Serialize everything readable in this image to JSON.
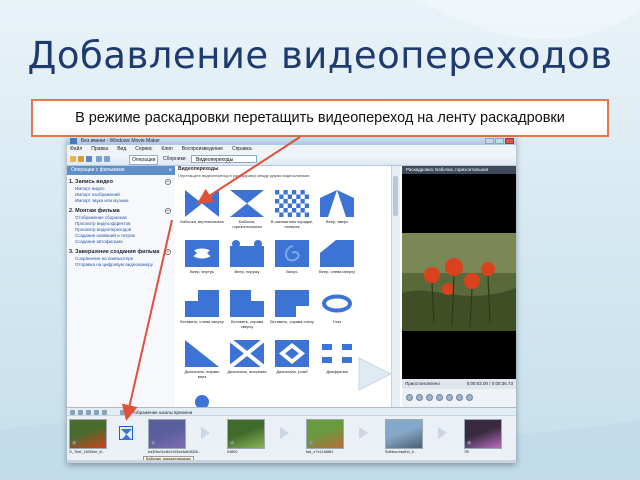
{
  "slide": {
    "title": "Добавление видеопереходов",
    "caption": "В режиме раскадровки перетащить видеопереход на ленту раскадровки"
  },
  "app": {
    "window_title": "Без имени - Windows Movie Maker",
    "menu": [
      "Файл",
      "Правка",
      "Вид",
      "Сервис",
      "Клип",
      "Воспроизведение",
      "Справка"
    ],
    "toolbar": {
      "tasks_label": "Операции",
      "collections_label": "Сборники",
      "collection_select": "Видеопереходы"
    },
    "task_pane": {
      "header": "Операции с фильмами",
      "sections": [
        {
          "number": "1.",
          "title": "Запись видео",
          "links": [
            "Импорт видео",
            "Импорт изображений",
            "Импорт звука или музыки"
          ]
        },
        {
          "number": "2.",
          "title": "Монтаж фильма",
          "links": [
            "Отображение сборников",
            "Просмотр видеоэффектов",
            "Просмотр видеопереходов",
            "Создание названий и титров",
            "Создание автофильма"
          ]
        },
        {
          "number": "3.",
          "title": "Завершение создания фильма",
          "links": [
            "Сохранение на компьютере",
            "Отправка на цифровую видеокамеру"
          ]
        }
      ]
    },
    "content": {
      "heading": "Видеопереходы",
      "subheading": "Перетащите видеопереход в раскадровку между двумя видеоклипами.",
      "transitions": [
        {
          "name": "Бабочка, вертикальная",
          "icon": "bowtie-vertical-icon"
        },
        {
          "name": "Бабочка, горизонтальная",
          "icon": "bowtie-horizontal-icon"
        },
        {
          "name": "В шахматном порядке, поперек",
          "icon": "checker-icon"
        },
        {
          "name": "Веер, вверх",
          "icon": "fan-up-icon"
        },
        {
          "name": "Веер, внутрь",
          "icon": "fan-in-icon"
        },
        {
          "name": "Веер, наружу",
          "icon": "fan-out-icon"
        },
        {
          "name": "Вихрь",
          "icon": "swirl-icon"
        },
        {
          "name": "Веер, слева сверху",
          "icon": "fan-topleft-icon"
        },
        {
          "name": "Вставить, слева сверху",
          "icon": "insert-topleft-icon"
        },
        {
          "name": "Вставить, справа сверху",
          "icon": "insert-topright-icon"
        },
        {
          "name": "Вставить, справа снизу",
          "icon": "insert-bottomright-icon"
        },
        {
          "name": "Глаз",
          "icon": "eye-icon"
        },
        {
          "name": "Диагональ, вправо вниз",
          "icon": "diagonal-down-icon"
        },
        {
          "name": "Диагональ, вихревая",
          "icon": "diagonal-cross-icon"
        },
        {
          "name": "Диагональ, ромб",
          "icon": "diamond-icon"
        },
        {
          "name": "Диафрагма",
          "icon": "iris-icon"
        },
        {
          "name": "",
          "icon": "circle-icon"
        }
      ]
    },
    "preview": {
      "title": "Раскадровка: Бабочка, горизонтальная",
      "status": "Приостановлено",
      "time": "0:00:02.00 / 0:00:36.73"
    },
    "storyboard": {
      "toolbar_label": "Отображение шкалы времени",
      "tooltip": "Бабочка, горизонтальная",
      "clips": [
        {
          "name": "G_7bef_180f3ee_ill..",
          "colors": [
            "#4b6b2d",
            "#d0401e"
          ]
        },
        {
          "name": "ba30bcf1efb1f1/f3ee8dk3f32b..",
          "colors": [
            "#5a5e9c",
            "#7d6bb0"
          ]
        },
        {
          "name": "04ff00",
          "colors": [
            "#406b2a",
            "#8cb45a"
          ]
        },
        {
          "name": "fad_e7e11888f1",
          "colors": [
            "#6a9a3e",
            "#b86b3a"
          ]
        },
        {
          "name": "Sdbbsv/cssfhh_ll..",
          "colors": [
            "#86a8c8",
            "#4b5f70"
          ]
        },
        {
          "name": "7f0",
          "colors": [
            "#3a2a3f",
            "#b56fbf"
          ]
        }
      ]
    }
  }
}
